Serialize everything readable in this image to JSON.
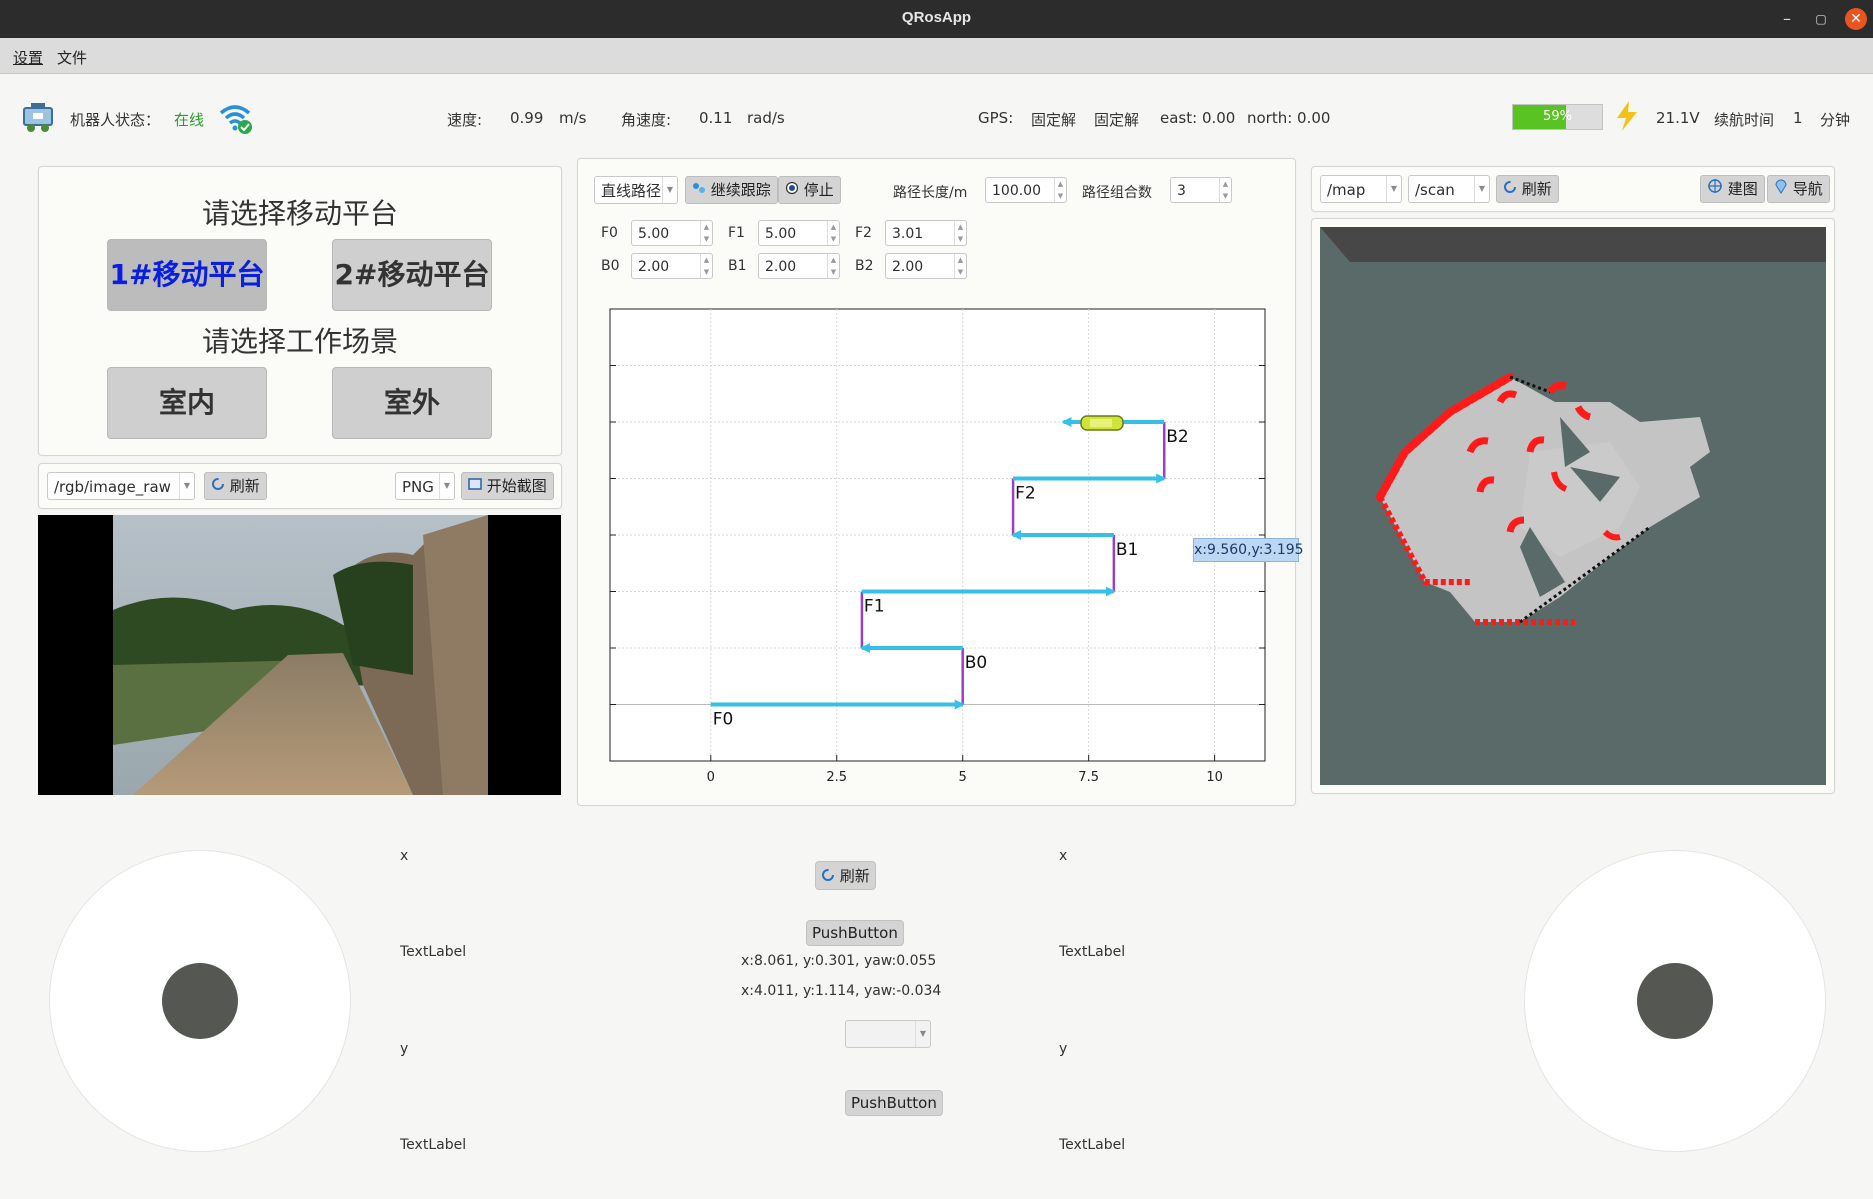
{
  "window": {
    "title": "QRosApp"
  },
  "menu": {
    "settings": "设置",
    "file": "文件"
  },
  "status": {
    "robot_state_label": "机器人状态：",
    "robot_state_value": "在线",
    "speed_label": "速度:",
    "speed_value": "0.99",
    "speed_unit": "m/s",
    "angular_label": "角速度:",
    "angular_value": "0.11",
    "angular_unit": "rad/s",
    "gps_label": "GPS:",
    "gps_value1": "固定解",
    "gps_value2": "固定解",
    "east": "east: 0.00",
    "north": "north: 0.00",
    "battery_percent": "59%",
    "battery_level": 0.59,
    "voltage": "21.1V",
    "endurance_label": "续航时间",
    "endurance_value": "1",
    "endurance_unit": "分钟",
    "colors": {
      "online": "#2a9d2a",
      "battery": "#58c322",
      "bolt": "#f2c21b"
    }
  },
  "platform_panel": {
    "title": "请选择移动平台",
    "platform1": "1#移动平台",
    "platform2": "2#移动平台",
    "scene_title": "请选择工作场景",
    "indoor": "室内",
    "outdoor": "室外"
  },
  "camera_panel": {
    "topic": "/rgb/image_raw",
    "refresh": "刷新",
    "format": "PNG",
    "screenshot": "开始截图"
  },
  "path_panel": {
    "path_type": "直线路径",
    "continue": "继续跟踪",
    "stop": "停止",
    "length_label": "路径长度/m",
    "length_value": "100.00",
    "combo_label": "路径组合数",
    "combo_value": "3",
    "params": [
      {
        "label": "F0",
        "value": "5.00"
      },
      {
        "label": "F1",
        "value": "5.00"
      },
      {
        "label": "F2",
        "value": "3.01"
      },
      {
        "label": "B0",
        "value": "2.00"
      },
      {
        "label": "B1",
        "value": "2.00"
      },
      {
        "label": "B2",
        "value": "2.00"
      }
    ]
  },
  "chart_data": {
    "type": "line",
    "title": "",
    "xlabel": "",
    "ylabel": "",
    "xlim": [
      -2,
      11
    ],
    "ylim": [
      -1,
      7
    ],
    "grid": true,
    "x_ticks": [
      "0",
      "2.5",
      "5",
      "7.5",
      "10"
    ],
    "segments": [
      {
        "name": "F0",
        "kind": "forward",
        "from": [
          0,
          0
        ],
        "to": [
          5,
          0
        ]
      },
      {
        "name": "B0",
        "kind": "backward",
        "from": [
          5,
          1
        ],
        "to": [
          3,
          1
        ]
      },
      {
        "name": "F1",
        "kind": "forward",
        "from": [
          3,
          2
        ],
        "to": [
          8,
          2
        ]
      },
      {
        "name": "B1",
        "kind": "backward",
        "from": [
          8,
          3
        ],
        "to": [
          6,
          3
        ]
      },
      {
        "name": "F2",
        "kind": "forward",
        "from": [
          6,
          4
        ],
        "to": [
          9,
          4
        ]
      },
      {
        "name": "B2",
        "kind": "backward",
        "from": [
          9,
          5
        ],
        "to": [
          7,
          5
        ]
      }
    ],
    "connectors": [
      {
        "from": [
          5,
          0
        ],
        "to": [
          5,
          1
        ]
      },
      {
        "from": [
          3,
          1
        ],
        "to": [
          3,
          2
        ]
      },
      {
        "from": [
          8,
          2
        ],
        "to": [
          8,
          3
        ]
      },
      {
        "from": [
          6,
          3
        ],
        "to": [
          6,
          4
        ]
      },
      {
        "from": [
          9,
          4
        ],
        "to": [
          9,
          5
        ]
      }
    ],
    "labels": [
      {
        "text": "F0",
        "x": 0,
        "y": 0
      },
      {
        "text": "B0",
        "x": 5,
        "y": 1
      },
      {
        "text": "F1",
        "x": 3,
        "y": 2
      },
      {
        "text": "B1",
        "x": 8,
        "y": 3
      },
      {
        "text": "F2",
        "x": 6,
        "y": 4
      },
      {
        "text": "B2",
        "x": 9,
        "y": 5
      }
    ],
    "cursor_readout": "x:9.560,y:3.195",
    "colors": {
      "arrow": "#35bfe9",
      "connector": "#9a3fc4"
    }
  },
  "map_panel": {
    "topic1": "/map",
    "topic2": "/scan",
    "refresh": "刷新",
    "build_map": "建图",
    "navigate": "导航"
  },
  "bottom": {
    "left": {
      "x_label": "x",
      "text1": "TextLabel",
      "y_label": "y",
      "text2": "TextLabel"
    },
    "right": {
      "x_label": "x",
      "text1": "TextLabel",
      "y_label": "y",
      "text2": "TextLabel"
    },
    "refresh": "刷新",
    "pushbutton1": "PushButton",
    "pose1": "x:8.061, y:0.301, yaw:0.055",
    "pose2": "x:4.011, y:1.114, yaw:-0.034",
    "pushbutton2": "PushButton"
  }
}
